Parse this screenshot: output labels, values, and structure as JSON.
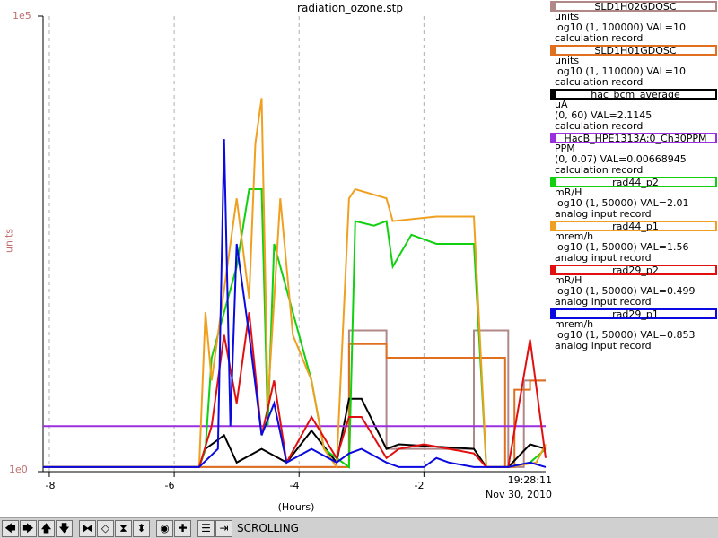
{
  "chart_data": {
    "type": "line",
    "title": "radiation_ozone.stp",
    "ylabel": "units",
    "y_tick_labels": [
      "1e5",
      "1e0"
    ],
    "xlabel": "(Hours)",
    "x_tick_labels": [
      "-8",
      "-6",
      "-4",
      "-2"
    ],
    "x_ticks": [
      -8,
      -6,
      -4,
      -2
    ],
    "xlim": [
      -8.1,
      -0.05
    ],
    "ylim": [
      0,
      1
    ],
    "grid": true,
    "time_label": "19:28:11",
    "date_label": "Nov 30, 2010",
    "series": [
      {
        "name": "SLD1H02GDOSC",
        "color": "#b08888",
        "x": [
          -8.1,
          -3.2,
          -3.2,
          -2.6,
          -2.6,
          -1.2,
          -1.2,
          -0.65,
          -0.65,
          -0.4,
          -0.4,
          -0.05
        ],
        "y": [
          0.01,
          0.01,
          0.31,
          0.31,
          0.05,
          0.05,
          0.31,
          0.31,
          0.01,
          0.01,
          0.2,
          0.2
        ]
      },
      {
        "name": "SLD1H01GDOSC",
        "color": "#e07020",
        "x": [
          -8.1,
          -3.2,
          -3.2,
          -2.6,
          -2.6,
          -1.2,
          -1.2,
          -0.7,
          -0.7,
          -0.55,
          -0.55,
          -0.3,
          -0.3,
          -0.05
        ],
        "y": [
          0.01,
          0.01,
          0.28,
          0.28,
          0.25,
          0.25,
          0.25,
          0.25,
          0.01,
          0.01,
          0.18,
          0.18,
          0.2,
          0.2
        ]
      },
      {
        "name": "hac_bcm_average",
        "color": "#000000",
        "x": [
          -8.1,
          -5.6,
          -5.5,
          -5.2,
          -5.0,
          -4.6,
          -4.2,
          -3.8,
          -3.4,
          -3.2,
          -3.0,
          -2.6,
          -2.4,
          -1.2,
          -1.0,
          -0.65,
          -0.3,
          -0.05
        ],
        "y": [
          0.01,
          0.01,
          0.05,
          0.08,
          0.02,
          0.05,
          0.02,
          0.09,
          0.02,
          0.16,
          0.16,
          0.05,
          0.06,
          0.05,
          0.01,
          0.01,
          0.06,
          0.05
        ]
      },
      {
        "name": "HacB_HPE1313A:0_Ch30PPM",
        "color": "#9a30e0",
        "x": [
          -8.1,
          -7.0,
          -6.0,
          -5.0,
          -4.0,
          -3.0,
          -2.0,
          -1.0,
          -0.05
        ],
        "y": [
          0.1,
          0.1,
          0.1,
          0.1,
          0.1,
          0.1,
          0.1,
          0.1,
          0.1
        ]
      },
      {
        "name": "rad44_p2",
        "color": "#10d010",
        "x": [
          -8.1,
          -5.6,
          -5.5,
          -5.4,
          -5.0,
          -4.8,
          -4.6,
          -4.5,
          -4.4,
          -3.8,
          -3.6,
          -3.2,
          -3.1,
          -2.8,
          -2.6,
          -2.5,
          -2.2,
          -1.8,
          -1.4,
          -1.2,
          -1.0,
          -0.65,
          -0.3,
          -0.05
        ],
        "y": [
          0.01,
          0.01,
          0.05,
          0.25,
          0.45,
          0.62,
          0.62,
          0.1,
          0.5,
          0.2,
          0.05,
          0.01,
          0.55,
          0.54,
          0.55,
          0.45,
          0.52,
          0.5,
          0.5,
          0.5,
          0.01,
          0.01,
          0.02,
          0.05
        ]
      },
      {
        "name": "rad44_p1",
        "color": "#f0a020",
        "x": [
          -8.1,
          -5.6,
          -5.5,
          -5.4,
          -5.0,
          -4.8,
          -4.7,
          -4.6,
          -4.5,
          -4.3,
          -4.1,
          -3.8,
          -3.6,
          -3.4,
          -3.2,
          -3.1,
          -2.6,
          -2.5,
          -1.8,
          -1.2,
          -1.0,
          -0.65,
          -0.2,
          -0.05
        ],
        "y": [
          0.01,
          0.01,
          0.35,
          0.2,
          0.6,
          0.38,
          0.72,
          0.82,
          0.15,
          0.6,
          0.3,
          0.2,
          0.05,
          0.01,
          0.6,
          0.62,
          0.6,
          0.55,
          0.56,
          0.56,
          0.01,
          0.01,
          0.02,
          0.06
        ]
      },
      {
        "name": "rad29_p2",
        "color": "#e01010",
        "x": [
          -8.1,
          -5.6,
          -5.4,
          -5.2,
          -5.0,
          -4.8,
          -4.6,
          -4.4,
          -4.2,
          -3.8,
          -3.4,
          -3.2,
          -3.0,
          -2.6,
          -2.4,
          -2.0,
          -1.6,
          -1.2,
          -1.0,
          -0.65,
          -0.3,
          -0.05
        ],
        "y": [
          0.01,
          0.01,
          0.1,
          0.3,
          0.15,
          0.35,
          0.08,
          0.2,
          0.02,
          0.12,
          0.03,
          0.12,
          0.12,
          0.03,
          0.05,
          0.06,
          0.05,
          0.04,
          0.01,
          0.01,
          0.29,
          0.03
        ]
      },
      {
        "name": "rad29_p1",
        "color": "#0a0ae0",
        "x": [
          -8.1,
          -5.6,
          -5.3,
          -5.2,
          -5.1,
          -5.0,
          -4.8,
          -4.6,
          -4.4,
          -4.2,
          -3.8,
          -3.4,
          -3.2,
          -3.0,
          -2.6,
          -2.4,
          -2.0,
          -1.8,
          -1.6,
          -1.2,
          -1.0,
          -0.65,
          -0.3,
          -0.05
        ],
        "y": [
          0.01,
          0.01,
          0.05,
          0.73,
          0.1,
          0.5,
          0.3,
          0.08,
          0.15,
          0.02,
          0.05,
          0.02,
          0.04,
          0.05,
          0.02,
          0.01,
          0.01,
          0.03,
          0.02,
          0.01,
          0.01,
          0.01,
          0.02,
          0.01
        ]
      }
    ]
  },
  "legend": [
    {
      "name": "SLD1H02GDOSC",
      "color": "#b08888",
      "lines": [
        "units",
        "log10 (1, 100000) VAL=10",
        "calculation record"
      ]
    },
    {
      "name": "SLD1H01GDOSC",
      "color": "#e07020",
      "lines": [
        "units",
        "log10 (1, 110000) VAL=10",
        "calculation record"
      ]
    },
    {
      "name": "hac_bcm_average",
      "color": "#000000",
      "lines": [
        "uA",
        "(0, 60) VAL=2.1145",
        "calculation record"
      ]
    },
    {
      "name": "HacB_HPE1313A:0_Ch30PPM",
      "color": "#9a30e0",
      "lines": [
        "PPM",
        "(0, 0.07) VAL=0.00668945",
        "calculation record"
      ]
    },
    {
      "name": "rad44_p2",
      "color": "#10d010",
      "lines": [
        "mR/H",
        "log10 (1, 50000) VAL=2.01",
        "analog input record"
      ]
    },
    {
      "name": "rad44_p1",
      "color": "#f0a020",
      "lines": [
        "mrem/h",
        "log10 (1, 50000) VAL=1.56",
        "analog input record"
      ]
    },
    {
      "name": "rad29_p2",
      "color": "#e01010",
      "lines": [
        "mR/H",
        "log10 (1, 50000) VAL=0.499",
        "analog input record"
      ]
    },
    {
      "name": "rad29_p1",
      "color": "#0a0ae0",
      "lines": [
        "mrem/h",
        "log10 (1, 50000) VAL=0.853",
        "analog input record"
      ]
    }
  ],
  "toolbar": {
    "buttons": [
      {
        "name": "pan-left-icon",
        "glyph": "🡄"
      },
      {
        "name": "pan-right-icon",
        "glyph": "🡆"
      },
      {
        "name": "pan-up-icon",
        "glyph": "🡅"
      },
      {
        "name": "pan-down-icon",
        "glyph": "🡇"
      },
      {
        "name": "zoom-in-horizontal-icon",
        "glyph": "⧓"
      },
      {
        "name": "zoom-out-horizontal-icon",
        "glyph": "◇"
      },
      {
        "name": "zoom-in-vertical-icon",
        "glyph": "⧗"
      },
      {
        "name": "zoom-out-vertical-icon",
        "glyph": "⬍"
      },
      {
        "name": "autoscale-icon",
        "glyph": "◉"
      },
      {
        "name": "reset-icon",
        "glyph": "✚"
      },
      {
        "name": "config-icon",
        "glyph": "☰"
      },
      {
        "name": "scroll-icon",
        "glyph": "⇥"
      }
    ],
    "status": "SCROLLING"
  }
}
